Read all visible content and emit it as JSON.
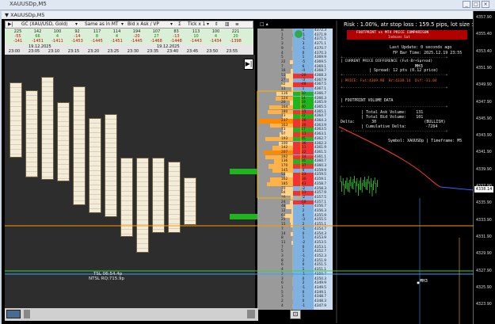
{
  "window": {
    "title": "XAUUSDp,M5",
    "chart_title": "▼ XAUUSDp,M5"
  },
  "toolbar": {
    "symbol": "GC (XAU/USD, Gold)",
    "mode": "Same as in MT",
    "bidask": "Bid x Ask / VP",
    "tick": "Tick x 1"
  },
  "volumes": {
    "row1": [
      "225",
      "142",
      "100",
      "92",
      "117",
      "114",
      "194",
      "107",
      "83",
      "113",
      "100",
      "221"
    ],
    "row2": [
      "-55",
      "66",
      "4",
      "-14",
      "8",
      "4",
      "-20",
      "27",
      "-13",
      "10",
      "4",
      "20"
    ],
    "row3": [
      "-141",
      "-1451",
      "-1411",
      "-1453",
      "-1445",
      "-1451",
      "-1445",
      "-1468",
      "-1448",
      "-1443",
      "-1434",
      "-1398"
    ]
  },
  "time": {
    "date_labels": [
      "19.12.2025",
      "19.12.2025"
    ],
    "ticks": [
      "23:00",
      "23:05",
      "23:10",
      "23:15",
      "23:20",
      "23:25",
      "23:30",
      "23:35",
      "23:40",
      "23:45",
      "23:50",
      "23:55"
    ]
  },
  "ladder": {
    "prices": [
      "4372.3",
      "4371.9",
      "4371.5",
      "4371.1",
      "4370.7",
      "4370.3",
      "4369.9",
      "4369.5",
      "4369.1",
      "4368.7",
      "4368.3",
      "4367.9",
      "4367.5",
      "4367.1",
      "4366.7",
      "4366.3",
      "4365.9",
      "4365.5",
      "4365.1",
      "4364.7",
      "4364.3",
      "4363.9",
      "4363.5",
      "4363.1",
      "4362.7",
      "4362.3",
      "4361.9",
      "4361.5",
      "4361.1",
      "4360.7",
      "4360.3",
      "4359.9",
      "4359.5",
      "4359.1",
      "4358.7",
      "4358.3",
      "4357.9",
      "4357.5",
      "4357.1",
      "4356.7",
      "4356.3",
      "4355.9",
      "4355.5",
      "4355.1",
      "4354.7",
      "4354.3",
      "4353.9",
      "4353.5",
      "4353.1",
      "4352.7",
      "4352.3",
      "4351.9",
      "4351.5",
      "4351.1",
      "4350.7",
      "4350.3",
      "4349.9",
      "4349.5",
      "4349.1",
      "4348.7",
      "4348.3",
      "4347.9"
    ],
    "vol": [
      "8",
      "1",
      "5",
      "3",
      "9",
      "4",
      "5",
      "22",
      "7",
      "16",
      "51",
      "27",
      "82",
      "11",
      "116",
      "124",
      "20",
      "164",
      "180",
      "73",
      "237",
      "163",
      "73",
      "97",
      "193",
      "100",
      "142",
      "207",
      "192",
      "136",
      "170",
      "145",
      "53",
      "162",
      "185",
      "70",
      "84",
      "16",
      "24",
      "48",
      "12",
      "64",
      "25",
      "15",
      "7",
      "14",
      "8",
      "11",
      "7",
      "5",
      "3",
      "8",
      "6",
      "4",
      "2",
      "3",
      "6",
      "1",
      "5",
      "3",
      "2",
      "4"
    ],
    "delta": [
      "1",
      "-1",
      "-1",
      "3",
      "-1",
      "0",
      "1",
      "-5",
      "6",
      "-4",
      "-20",
      "-3",
      "-48",
      "1",
      "10",
      "14",
      "19",
      "40",
      "-15",
      "22",
      "-26",
      "-20",
      "17",
      "-11",
      "45",
      "-36",
      "-11",
      "-22",
      "-14",
      "16",
      "-37",
      "0",
      "-23",
      "-30",
      "-43",
      "-2",
      "-11",
      "-2",
      "-10",
      "5",
      "2",
      "4",
      "-3",
      "2",
      "-1",
      "0",
      "1",
      "-2",
      "0",
      "1",
      "-1",
      "2",
      "0",
      "1",
      "-1",
      "0",
      "2",
      "-1",
      "0",
      "1",
      "0",
      "-1"
    ]
  },
  "panel": {
    "risk": "Risk : 1.00%, atr stop loss : 159.5 pips, lot size : 7.29",
    "subtitle": "FOOTPRINT vs MT4 PRICE COMPARISON",
    "sub2": "Indexes Sat",
    "last_update": "Last Update: 0 seconds ago",
    "fp_bar_time": "FP Bar Time: 2025.12.19 23:55",
    "mh3": "MH3",
    "current_diff": "| CURRENT PRICE DIFFERENCE (Fut-Br+Spread)",
    "spread": "| Spread: 12 pts (0.12 price)",
    "price_line": "| PRICE: Fut:4369.90  Br:4338.14  Dif:-31.04",
    "volume_header": "| FOOTPRINT VOLUME DATA",
    "ask_vol": "| Total Ask Volume:    131",
    "bid_vol": "| Total Bid Volume:    101",
    "delta": "Delta:       30                    (BULLISH)",
    "cum_delta": "| Cumulative Delta:        -7284",
    "symbol_line": "Symbol: XAUUSDp | Timeframe: M5",
    "mh3_b": "MH3"
  },
  "price_axis": [
    "4357.90",
    "4355.40",
    "4353.40",
    "4351.90",
    "4349.90",
    "4347.90",
    "4345.90",
    "4343.90",
    "4341.90",
    "4339.90",
    "4337.90",
    "4335.90",
    "4333.90",
    "4331.90",
    "4329.90",
    "4327.90",
    "4325.90",
    "4323.90"
  ],
  "price_tag": "4338.14",
  "overlay": {
    "tsl": "TSL 06:54.4p",
    "ntsl": "NTSL RQ:715.9p"
  },
  "colors": {
    "accent": "#ff2a00",
    "buy": "#1fb51f",
    "sell": "#e33",
    "vpoc": "#ffb000"
  }
}
